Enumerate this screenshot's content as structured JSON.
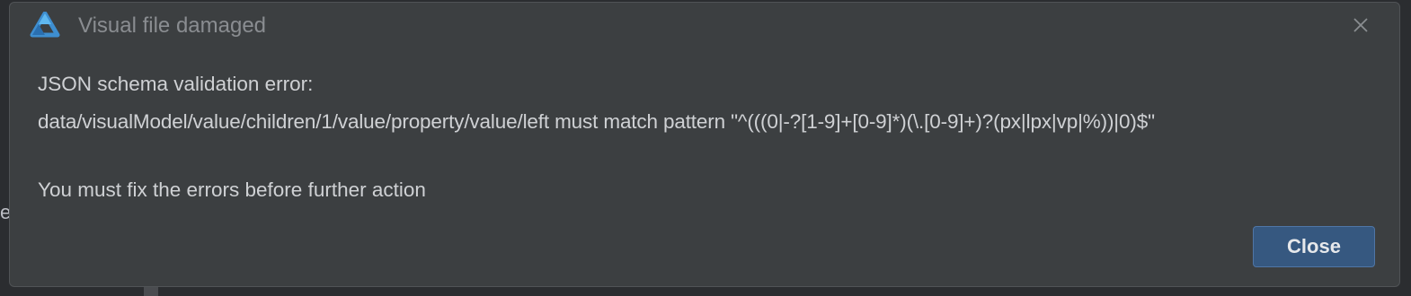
{
  "background": {
    "partial_text": "e"
  },
  "dialog": {
    "title": "Visual file damaged",
    "icon": "app-logo-icon",
    "close_icon": "close-icon",
    "message": {
      "line1": "JSON schema validation error:",
      "line2": "data/visualModel/value/children/1/value/property/value/left must match pattern \"^(((0|-?[1-9]+[0-9]*)(\\.[0-9]+)?(px|lpx|vp|%))|0)$\"",
      "line3": "You must fix the errors before further action"
    },
    "buttons": {
      "close_label": "Close"
    }
  },
  "colors": {
    "dialog_bg": "#3c3f41",
    "title_text": "#8a8d91",
    "body_text": "#cfd1d4",
    "primary_button": "#365880"
  }
}
